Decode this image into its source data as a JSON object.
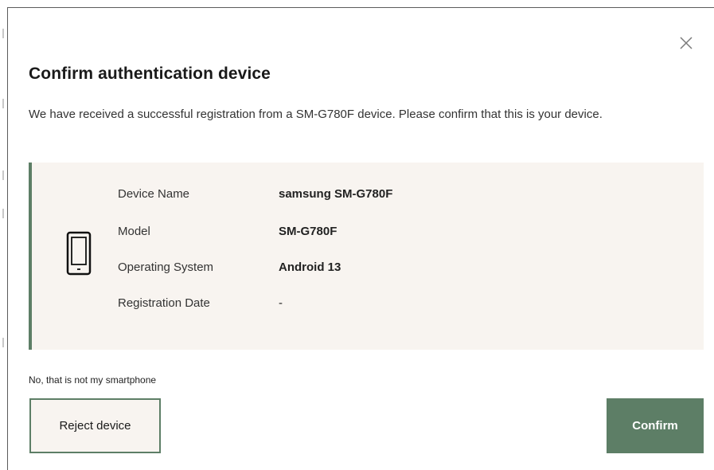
{
  "dialog": {
    "title": "Confirm authentication device",
    "description": "We have received a successful registration from a SM-G780F device. Please confirm that this is your device.",
    "close_icon": "close-icon"
  },
  "device": {
    "icon": "smartphone-icon",
    "fields": [
      {
        "label": "Device Name",
        "value": "samsung SM-G780F"
      },
      {
        "label": "Model",
        "value": "SM-G780F"
      },
      {
        "label": "Operating System",
        "value": "Android 13"
      },
      {
        "label": "Registration Date",
        "value": "-"
      }
    ]
  },
  "actions": {
    "not_mine_text": "No, that is not my smartphone",
    "reject_label": "Reject device",
    "confirm_label": "Confirm"
  },
  "colors": {
    "accent": "#5d7e66",
    "card_background": "#f8f4f0",
    "text": "#222222"
  }
}
